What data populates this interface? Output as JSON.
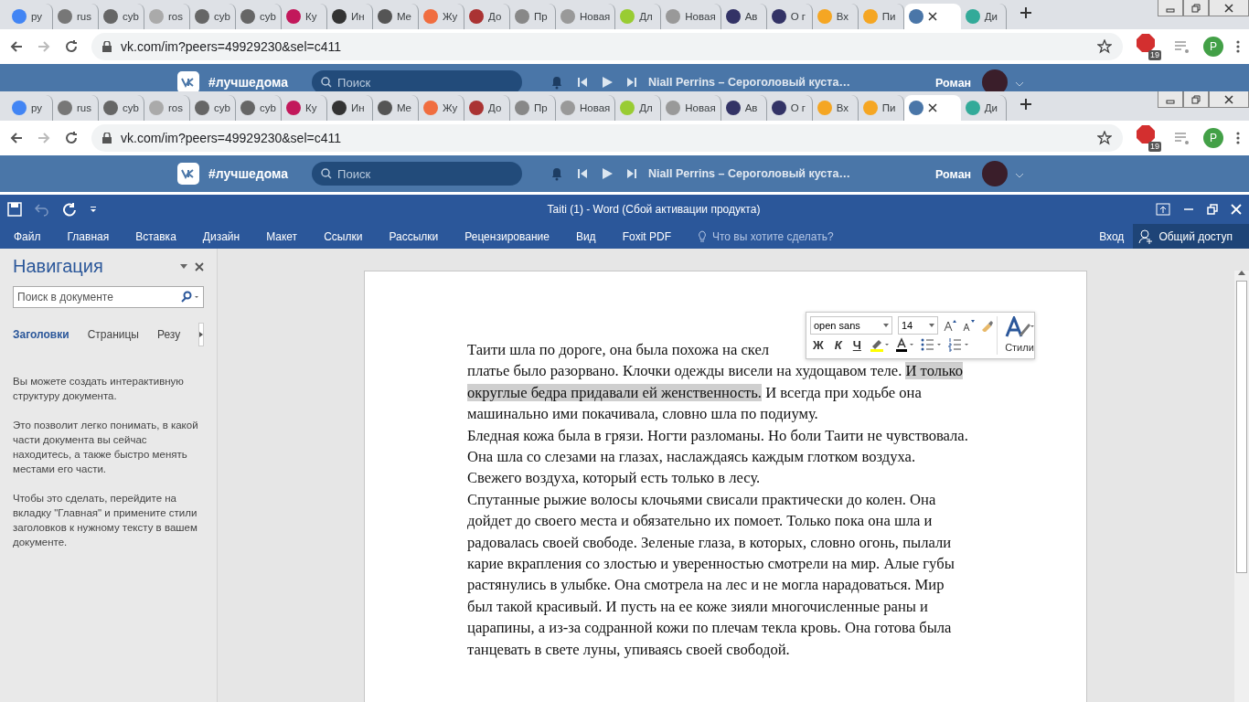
{
  "browser_frames": [
    {
      "tabs": [
        {
          "label": "ру",
          "selected": false
        },
        {
          "label": "rus",
          "selected": false
        },
        {
          "label": "cyb",
          "selected": false
        },
        {
          "label": "ros",
          "selected": false
        },
        {
          "label": "cyb",
          "selected": false
        },
        {
          "label": "cyb",
          "selected": false
        },
        {
          "label": "Ку",
          "selected": false
        },
        {
          "label": "Ин",
          "selected": false
        },
        {
          "label": "Me",
          "selected": false
        },
        {
          "label": "Жу",
          "selected": false
        },
        {
          "label": "До",
          "selected": false
        },
        {
          "label": "Пр",
          "selected": false
        },
        {
          "label": "Новая",
          "selected": false
        },
        {
          "label": "Дл",
          "selected": false
        },
        {
          "label": "Новая",
          "selected": false
        },
        {
          "label": "Ав",
          "selected": false
        },
        {
          "label": "О г",
          "selected": false
        },
        {
          "label": "Вх",
          "selected": false
        },
        {
          "label": "Пи",
          "selected": false
        },
        {
          "selected": true
        },
        {
          "label": "Ди",
          "selected": false
        }
      ],
      "address": "vk.com/im?peers=49929230&sel=c411",
      "adblock_count": "19",
      "profile_initial": "P",
      "vk": {
        "hashtag": "#лучшедома",
        "search_placeholder": "Поиск",
        "track": "Niall Perrins – Сероголовый куста…",
        "user": "Роман"
      }
    },
    {
      "tabs": [
        {
          "label": "ру",
          "selected": false
        },
        {
          "label": "rus",
          "selected": false
        },
        {
          "label": "cyb",
          "selected": false
        },
        {
          "label": "ros",
          "selected": false
        },
        {
          "label": "cyb",
          "selected": false
        },
        {
          "label": "cyb",
          "selected": false
        },
        {
          "label": "Ку",
          "selected": false
        },
        {
          "label": "Ин",
          "selected": false
        },
        {
          "label": "Me",
          "selected": false
        },
        {
          "label": "Жу",
          "selected": false
        },
        {
          "label": "До",
          "selected": false
        },
        {
          "label": "Пр",
          "selected": false
        },
        {
          "label": "Новая",
          "selected": false
        },
        {
          "label": "Дл",
          "selected": false
        },
        {
          "label": "Новая",
          "selected": false
        },
        {
          "label": "Ав",
          "selected": false
        },
        {
          "label": "О г",
          "selected": false
        },
        {
          "label": "Вх",
          "selected": false
        },
        {
          "label": "Пи",
          "selected": false
        },
        {
          "selected": true
        },
        {
          "label": "Ди",
          "selected": false
        }
      ],
      "address": "vk.com/im?peers=49929230&sel=c411",
      "adblock_count": "19",
      "profile_initial": "P",
      "vk": {
        "hashtag": "#лучшедома",
        "search_placeholder": "Поиск",
        "track": "Niall Perrins – Сероголовый куста…",
        "user": "Роман"
      }
    }
  ],
  "word": {
    "title": "Taiti (1) - Word (Сбой активации продукта)",
    "menu": [
      "Файл",
      "Главная",
      "Вставка",
      "Дизайн",
      "Макет",
      "Ссылки",
      "Рассылки",
      "Рецензирование",
      "Вид",
      "Foxit PDF"
    ],
    "tell_me": "Что вы хотите сделать?",
    "sign_in": "Вход",
    "share": "Общий доступ"
  },
  "navigation": {
    "title": "Навигация",
    "search_placeholder": "Поиск в документе",
    "tabs": [
      {
        "label": "Заголовки",
        "selected": true
      },
      {
        "label": "Страницы",
        "selected": false
      },
      {
        "label": "Резу",
        "selected": false
      }
    ],
    "paragraphs": [
      "Вы можете создать интерактивную структуру документа.",
      "Это позволит легко понимать, в какой части документа вы сейчас находитесь, а также быстро менять местами его части.",
      "Чтобы это сделать, перейдите на вкладку \"Главная\" и примените стили заголовков к нужному тексту в вашем документе."
    ]
  },
  "mini_toolbar": {
    "font": "open sans",
    "size": "14",
    "bold": "Ж",
    "italic": "К",
    "underline": "Ч",
    "styles": "Стили"
  },
  "document": {
    "paragraphs": [
      {
        "lines": [
          [
            {
              "text": "Таити шла по дороге, она была похожа на скел",
              "selected": false
            }
          ],
          [
            {
              "text": "платье было разорвано. Клочки одежды висели на худощавом теле. ",
              "selected": false
            },
            {
              "text": "И только",
              "selected": true
            }
          ],
          [
            {
              "text": "округлые бедра придавали ей женственность.",
              "selected": true
            },
            {
              "text": " И всегда при ходьбе она",
              "selected": false
            }
          ],
          [
            {
              "text": "машинально ими покачивала, словно шла по подиуму.",
              "selected": false
            }
          ]
        ]
      },
      {
        "lines": [
          [
            {
              "text": "Бледная кожа была в грязи. Ногти разломаны. Но боли Таити не чувствовала.",
              "selected": false
            }
          ],
          [
            {
              "text": "Она шла со слезами на глазах, наслаждаясь каждым глотком воздуха.",
              "selected": false
            }
          ],
          [
            {
              "text": "Свежего воздуха, который есть только в лесу.",
              "selected": false
            }
          ]
        ]
      },
      {
        "lines": [
          [
            {
              "text": "Спутанные рыжие волосы клочьями свисали практически до колен. Она",
              "selected": false
            }
          ],
          [
            {
              "text": "дойдет до своего места и обязательно их помоет. Только пока она шла и",
              "selected": false
            }
          ],
          [
            {
              "text": "радовалась своей свободе. Зеленые глаза, в которых, словно огонь, пылали",
              "selected": false
            }
          ],
          [
            {
              "text": "карие вкрапления со злостью и уверенностью смотрели на мир. Алые губы",
              "selected": false
            }
          ],
          [
            {
              "text": "растянулись в улыбке. Она смотрела на лес и не могла нарадоваться. Мир",
              "selected": false
            }
          ],
          [
            {
              "text": "был такой красивый. И пусть на ее коже зияли многочисленные раны и",
              "selected": false
            }
          ],
          [
            {
              "text": "царапины, а из-за содранной кожи по плечам текла кровь. Она готова была",
              "selected": false
            }
          ],
          [
            {
              "text": "танцевать в свете луны, упиваясь своей свободой.",
              "selected": false
            }
          ]
        ]
      }
    ]
  }
}
